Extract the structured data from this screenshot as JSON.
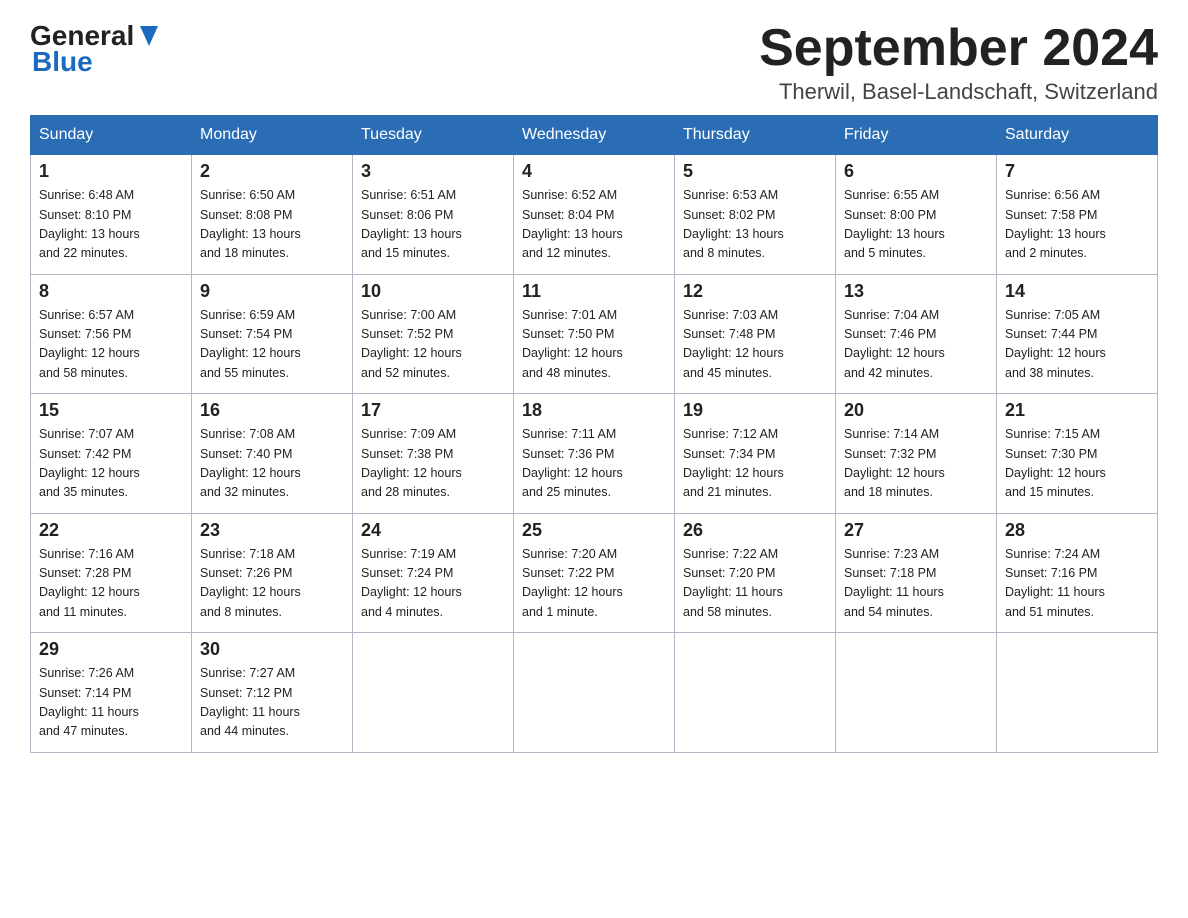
{
  "header": {
    "logo_general": "General",
    "logo_blue": "Blue",
    "month_title": "September 2024",
    "location": "Therwil, Basel-Landschaft, Switzerland"
  },
  "days_of_week": [
    "Sunday",
    "Monday",
    "Tuesday",
    "Wednesday",
    "Thursday",
    "Friday",
    "Saturday"
  ],
  "weeks": [
    [
      {
        "day": "1",
        "sunrise": "6:48 AM",
        "sunset": "8:10 PM",
        "daylight": "13 hours and 22 minutes."
      },
      {
        "day": "2",
        "sunrise": "6:50 AM",
        "sunset": "8:08 PM",
        "daylight": "13 hours and 18 minutes."
      },
      {
        "day": "3",
        "sunrise": "6:51 AM",
        "sunset": "8:06 PM",
        "daylight": "13 hours and 15 minutes."
      },
      {
        "day": "4",
        "sunrise": "6:52 AM",
        "sunset": "8:04 PM",
        "daylight": "13 hours and 12 minutes."
      },
      {
        "day": "5",
        "sunrise": "6:53 AM",
        "sunset": "8:02 PM",
        "daylight": "13 hours and 8 minutes."
      },
      {
        "day": "6",
        "sunrise": "6:55 AM",
        "sunset": "8:00 PM",
        "daylight": "13 hours and 5 minutes."
      },
      {
        "day": "7",
        "sunrise": "6:56 AM",
        "sunset": "7:58 PM",
        "daylight": "13 hours and 2 minutes."
      }
    ],
    [
      {
        "day": "8",
        "sunrise": "6:57 AM",
        "sunset": "7:56 PM",
        "daylight": "12 hours and 58 minutes."
      },
      {
        "day": "9",
        "sunrise": "6:59 AM",
        "sunset": "7:54 PM",
        "daylight": "12 hours and 55 minutes."
      },
      {
        "day": "10",
        "sunrise": "7:00 AM",
        "sunset": "7:52 PM",
        "daylight": "12 hours and 52 minutes."
      },
      {
        "day": "11",
        "sunrise": "7:01 AM",
        "sunset": "7:50 PM",
        "daylight": "12 hours and 48 minutes."
      },
      {
        "day": "12",
        "sunrise": "7:03 AM",
        "sunset": "7:48 PM",
        "daylight": "12 hours and 45 minutes."
      },
      {
        "day": "13",
        "sunrise": "7:04 AM",
        "sunset": "7:46 PM",
        "daylight": "12 hours and 42 minutes."
      },
      {
        "day": "14",
        "sunrise": "7:05 AM",
        "sunset": "7:44 PM",
        "daylight": "12 hours and 38 minutes."
      }
    ],
    [
      {
        "day": "15",
        "sunrise": "7:07 AM",
        "sunset": "7:42 PM",
        "daylight": "12 hours and 35 minutes."
      },
      {
        "day": "16",
        "sunrise": "7:08 AM",
        "sunset": "7:40 PM",
        "daylight": "12 hours and 32 minutes."
      },
      {
        "day": "17",
        "sunrise": "7:09 AM",
        "sunset": "7:38 PM",
        "daylight": "12 hours and 28 minutes."
      },
      {
        "day": "18",
        "sunrise": "7:11 AM",
        "sunset": "7:36 PM",
        "daylight": "12 hours and 25 minutes."
      },
      {
        "day": "19",
        "sunrise": "7:12 AM",
        "sunset": "7:34 PM",
        "daylight": "12 hours and 21 minutes."
      },
      {
        "day": "20",
        "sunrise": "7:14 AM",
        "sunset": "7:32 PM",
        "daylight": "12 hours and 18 minutes."
      },
      {
        "day": "21",
        "sunrise": "7:15 AM",
        "sunset": "7:30 PM",
        "daylight": "12 hours and 15 minutes."
      }
    ],
    [
      {
        "day": "22",
        "sunrise": "7:16 AM",
        "sunset": "7:28 PM",
        "daylight": "12 hours and 11 minutes."
      },
      {
        "day": "23",
        "sunrise": "7:18 AM",
        "sunset": "7:26 PM",
        "daylight": "12 hours and 8 minutes."
      },
      {
        "day": "24",
        "sunrise": "7:19 AM",
        "sunset": "7:24 PM",
        "daylight": "12 hours and 4 minutes."
      },
      {
        "day": "25",
        "sunrise": "7:20 AM",
        "sunset": "7:22 PM",
        "daylight": "12 hours and 1 minute."
      },
      {
        "day": "26",
        "sunrise": "7:22 AM",
        "sunset": "7:20 PM",
        "daylight": "11 hours and 58 minutes."
      },
      {
        "day": "27",
        "sunrise": "7:23 AM",
        "sunset": "7:18 PM",
        "daylight": "11 hours and 54 minutes."
      },
      {
        "day": "28",
        "sunrise": "7:24 AM",
        "sunset": "7:16 PM",
        "daylight": "11 hours and 51 minutes."
      }
    ],
    [
      {
        "day": "29",
        "sunrise": "7:26 AM",
        "sunset": "7:14 PM",
        "daylight": "11 hours and 47 minutes."
      },
      {
        "day": "30",
        "sunrise": "7:27 AM",
        "sunset": "7:12 PM",
        "daylight": "11 hours and 44 minutes."
      },
      null,
      null,
      null,
      null,
      null
    ]
  ],
  "labels": {
    "sunrise": "Sunrise:",
    "sunset": "Sunset:",
    "daylight": "Daylight:"
  }
}
